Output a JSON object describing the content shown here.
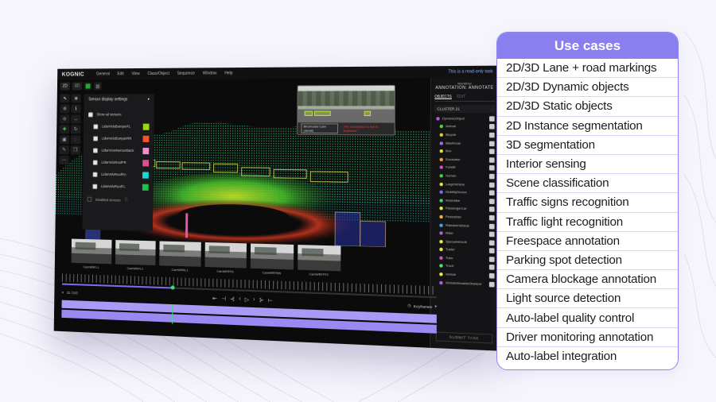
{
  "use_cases": {
    "title": "Use cases",
    "items": [
      "2D/3D Lane + road markings",
      "2D/3D Dynamic objects",
      "2D/3D Static objects",
      "2D Instance segmentation",
      "3D segmentation",
      "Interior sensing",
      "Scene classification",
      "Traffic signs recognition",
      "Traffic light recognition",
      "Freespace annotation",
      "Parking spot detection",
      "Camera blockage annotation",
      "Light source detection",
      "Auto-label quality control",
      "Driver monitoring annotation",
      "Auto-label integration"
    ],
    "accent": "#8b7ff0"
  },
  "app": {
    "logo": "KOGNIC",
    "menu": [
      "General",
      "Edit",
      "View",
      "Class/Object",
      "Sequence",
      "Window",
      "Help"
    ],
    "menu_right": "This is a read-only task",
    "view_modes": [
      "2D",
      "3D"
    ],
    "active_view_mode": "3D",
    "sensor_panel": {
      "title": "Sensor display settings",
      "show_all_label": "Show all sensors",
      "sensors": [
        {
          "name": "LidarVeloBumperFL",
          "color": "#9ad61c"
        },
        {
          "name": "LidarVeloBumperRR",
          "color": "#f0552c"
        },
        {
          "name": "LidarVoxelsensorBack",
          "color": "#f28ecb"
        },
        {
          "name": "LidarVeloRoofFR",
          "color": "#e0508e"
        },
        {
          "name": "LidarVeloRoofRA",
          "color": "#19d9d9"
        },
        {
          "name": "LidarVeloRoofFL",
          "color": "#1fc04a"
        }
      ],
      "disabled_label": "Disabled sensors"
    },
    "minimap": {
      "label": "Birdmodel Cam (detail)",
      "warning": "The annotation is not in keyframe"
    },
    "right_panel": {
      "subtitle": "Workflow",
      "title": "ANNOTATION: ANNOTATE",
      "tabs": [
        "OBJECTS",
        "EDIT"
      ],
      "cluster": "CLUSTER 21",
      "classes": [
        {
          "name": "DynamicObject",
          "color": "#b45ce0"
        },
        {
          "name": "Animal",
          "color": "#52d04a"
        },
        {
          "name": "Bicycle",
          "color": "#f2c531"
        },
        {
          "name": "BikeRoute",
          "color": "#a56cf0"
        },
        {
          "name": "Bus",
          "color": "#e2e23a"
        },
        {
          "name": "Excavator",
          "color": "#f2a431"
        },
        {
          "name": "Forklift",
          "color": "#e049c9"
        },
        {
          "name": "Human",
          "color": "#52d04a"
        },
        {
          "name": "LargeVehicle",
          "color": "#e8e044"
        },
        {
          "name": "MobilityDevice",
          "color": "#7b6cf0"
        },
        {
          "name": "Motorbike",
          "color": "#48d07a"
        },
        {
          "name": "PassengerCar",
          "color": "#eeee30"
        },
        {
          "name": "Pedestrian",
          "color": "#f2b331"
        },
        {
          "name": "RideableVehicle",
          "color": "#38a8e8"
        },
        {
          "name": "Rider",
          "color": "#b45ce0"
        },
        {
          "name": "SpecialVehicle",
          "color": "#eeee30"
        },
        {
          "name": "Trailer",
          "color": "#f2e34a"
        },
        {
          "name": "Tram",
          "color": "#e049c9"
        },
        {
          "name": "Truck",
          "color": "#52e07a"
        },
        {
          "name": "Vehicle",
          "color": "#eeee30"
        },
        {
          "name": "VehicleMovableObstacle",
          "color": "#b45ce0"
        }
      ],
      "submit_label": "SUBMIT TASK"
    },
    "cameras": [
      "CamWRFL1",
      "CamWRFL2",
      "CamWRRL1",
      "CamWRFR1",
      "CamWRFRW",
      "CamWRFFF2"
    ],
    "frame_counter": "32 /100",
    "keyframes_label": "Keyframes",
    "playback_progress": 0.31,
    "playback_icons": [
      "skip-start-icon",
      "prev-keyframe-icon",
      "prev-keyframe-alt-icon",
      "step-back-icon",
      "play-icon",
      "step-forward-icon",
      "next-keyframe-icon",
      "next-keyframe-alt-icon"
    ]
  }
}
